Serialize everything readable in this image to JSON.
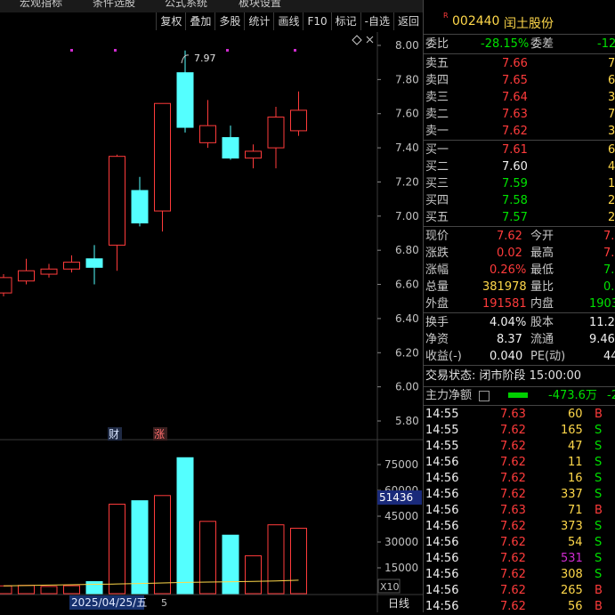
{
  "top_menu": [
    "宏观指标",
    "条件选股",
    "公式系统",
    "板块设置"
  ],
  "toolbar": [
    "复权",
    "叠加",
    "多股",
    "统计",
    "画线",
    "F10",
    "标记",
    "-自选",
    "返回"
  ],
  "stock": {
    "badge": "R",
    "code": "002440",
    "name": "闰土股份"
  },
  "chart": {
    "price_axis": [
      "8.00",
      "7.80",
      "7.60",
      "7.40",
      "7.20",
      "7.00",
      "6.80",
      "6.60",
      "6.40",
      "6.20",
      "6.00",
      "5.80"
    ],
    "high_marker": "7.97",
    "event_labels": [
      "财",
      "涨"
    ],
    "volume_axis": [
      "75000",
      "60000",
      "45000",
      "30000",
      "15000"
    ],
    "volume_current": "51436",
    "volume_unit": "X10",
    "date_label": "2025/04/25/五",
    "date_suffix": "5",
    "period": "日线",
    "candles": [
      {
        "o": 6.55,
        "c": 6.64,
        "h": 6.66,
        "l": 6.53,
        "v": 4500
      },
      {
        "o": 6.62,
        "c": 6.68,
        "h": 6.75,
        "l": 6.6,
        "v": 4800
      },
      {
        "o": 6.66,
        "c": 6.69,
        "h": 6.72,
        "l": 6.64,
        "v": 4200
      },
      {
        "o": 6.69,
        "c": 6.73,
        "h": 6.77,
        "l": 6.67,
        "v": 4600
      },
      {
        "o": 6.75,
        "c": 6.7,
        "h": 6.83,
        "l": 6.6,
        "v": 7000
      },
      {
        "o": 6.83,
        "c": 7.35,
        "h": 7.36,
        "l": 6.68,
        "v": 52000
      },
      {
        "o": 7.15,
        "c": 6.96,
        "h": 7.23,
        "l": 6.94,
        "v": 54000
      },
      {
        "o": 7.03,
        "c": 7.66,
        "h": 7.66,
        "l": 6.91,
        "v": 57000
      },
      {
        "o": 7.84,
        "c": 7.52,
        "h": 7.97,
        "l": 7.49,
        "v": 79000
      },
      {
        "o": 7.43,
        "c": 7.53,
        "h": 7.68,
        "l": 7.4,
        "v": 42000
      },
      {
        "o": 7.46,
        "c": 7.34,
        "h": 7.53,
        "l": 7.33,
        "v": 34000
      },
      {
        "o": 7.34,
        "c": 7.38,
        "h": 7.42,
        "l": 7.28,
        "v": 22000
      },
      {
        "o": 7.4,
        "c": 7.58,
        "h": 7.64,
        "l": 7.28,
        "v": 40000
      },
      {
        "o": 7.5,
        "c": 7.62,
        "h": 7.73,
        "l": 7.47,
        "v": 38000
      }
    ],
    "ma_values": [
      4500,
      4700,
      5000,
      5200,
      5400,
      5600,
      5900,
      6200,
      6500,
      6700,
      6900,
      7100,
      7400,
      7800
    ],
    "colors": {
      "up": "#ff3b3b",
      "down": "#54ffff",
      "axis_text": "#c0c0c0",
      "grid": "#2a2a2a",
      "ma": "#ffd84a"
    }
  },
  "panel": {
    "weibi": {
      "label": "委比",
      "value": "-28.15%",
      "label2": "委差",
      "value2": "-12"
    },
    "sell": [
      {
        "label": "卖五",
        "price": "7.66",
        "vol": "7"
      },
      {
        "label": "卖四",
        "price": "7.65",
        "vol": "6"
      },
      {
        "label": "卖三",
        "price": "7.64",
        "vol": "3"
      },
      {
        "label": "卖二",
        "price": "7.63",
        "vol": "7"
      },
      {
        "label": "卖一",
        "price": "7.62",
        "vol": "3"
      }
    ],
    "buy": [
      {
        "label": "买一",
        "price": "7.61",
        "vol": "6"
      },
      {
        "label": "买二",
        "price": "7.60",
        "vol": "4"
      },
      {
        "label": "买三",
        "price": "7.59",
        "vol": "1"
      },
      {
        "label": "买四",
        "price": "7.58",
        "vol": "2"
      },
      {
        "label": "买五",
        "price": "7.57",
        "vol": "2"
      }
    ],
    "stats": [
      {
        "l1": "现价",
        "v1": "7.62",
        "l2": "今开",
        "v2": "7."
      },
      {
        "l1": "涨跌",
        "v1": "0.02",
        "l2": "最高",
        "v2": "7."
      },
      {
        "l1": "涨幅",
        "v1": "0.26%",
        "l2": "最低",
        "v2": "7."
      },
      {
        "l1": "总量",
        "v1": "381978",
        "l2": "量比",
        "v2": "0."
      },
      {
        "l1": "外盘",
        "v1": "191581",
        "l2": "内盘",
        "v2": "1903"
      }
    ],
    "fund": [
      {
        "l1": "换手",
        "v1": "4.04%",
        "l2": "股本",
        "v2": "11.2"
      },
      {
        "l1": "净资",
        "v1": "8.37",
        "l2": "流通",
        "v2": "9.46"
      },
      {
        "l1": "收益(-)",
        "v1": "0.040",
        "l2": "PE(动)",
        "v2": "44"
      }
    ],
    "trade_status": "交易状态: 闭市阶段 15:00:00",
    "main_flow": {
      "label": "主力净额",
      "value": "-473.6万",
      "extra": "-2"
    },
    "ticks": [
      {
        "t": "14:55",
        "p": "7.63",
        "v": "60",
        "d": "B"
      },
      {
        "t": "14:55",
        "p": "7.62",
        "v": "165",
        "d": "S"
      },
      {
        "t": "14:55",
        "p": "7.62",
        "v": "47",
        "d": "S"
      },
      {
        "t": "14:56",
        "p": "7.62",
        "v": "11",
        "d": "S"
      },
      {
        "t": "14:56",
        "p": "7.62",
        "v": "16",
        "d": "S"
      },
      {
        "t": "14:56",
        "p": "7.62",
        "v": "337",
        "d": "S"
      },
      {
        "t": "14:56",
        "p": "7.63",
        "v": "71",
        "d": "B"
      },
      {
        "t": "14:56",
        "p": "7.62",
        "v": "373",
        "d": "S"
      },
      {
        "t": "14:56",
        "p": "7.62",
        "v": "54",
        "d": "S"
      },
      {
        "t": "14:56",
        "p": "7.62",
        "v": "531",
        "d": "S"
      },
      {
        "t": "14:56",
        "p": "7.62",
        "v": "308",
        "d": "S"
      },
      {
        "t": "14:56",
        "p": "7.62",
        "v": "265",
        "d": "B"
      },
      {
        "t": "14:56",
        "p": "7.62",
        "v": "56",
        "d": "B"
      }
    ]
  }
}
